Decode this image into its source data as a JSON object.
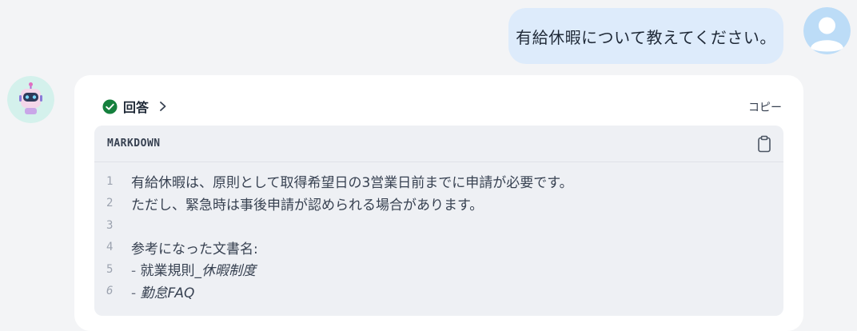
{
  "chat": {
    "user_message": "有給休暇について教えてください。",
    "answer_toggle_label": "回答",
    "copy_label": "コピー",
    "code_block": {
      "language": "MARKDOWN",
      "lines": [
        {
          "number": "1",
          "text": "有給休暇は、原則として取得希望日の3営業日前までに申請が必要です。"
        },
        {
          "number": "2",
          "text": "ただし、緊急時は事後申請が認められる場合があります。"
        },
        {
          "number": "3",
          "text": ""
        },
        {
          "number": "4",
          "text": "参考になった文書名:"
        },
        {
          "number": "5",
          "dash": "- ",
          "prefix": "就業規則_",
          "emphasis": "休暇制度"
        },
        {
          "number": "6",
          "dash": "- ",
          "prefix": "",
          "emphasis": "勤怠FAQ"
        }
      ]
    }
  },
  "icons": {
    "user_avatar": "user-avatar-icon",
    "bot_avatar": "robot-icon",
    "answer_status": "check-circle-icon",
    "expand": "chevron-right-icon",
    "copy_code": "clipboard-icon"
  },
  "colors": {
    "user_bubble": "#ddebfb",
    "check_green": "#15803d",
    "code_background": "#eef0f4",
    "page_background": "#f3f4f6"
  }
}
